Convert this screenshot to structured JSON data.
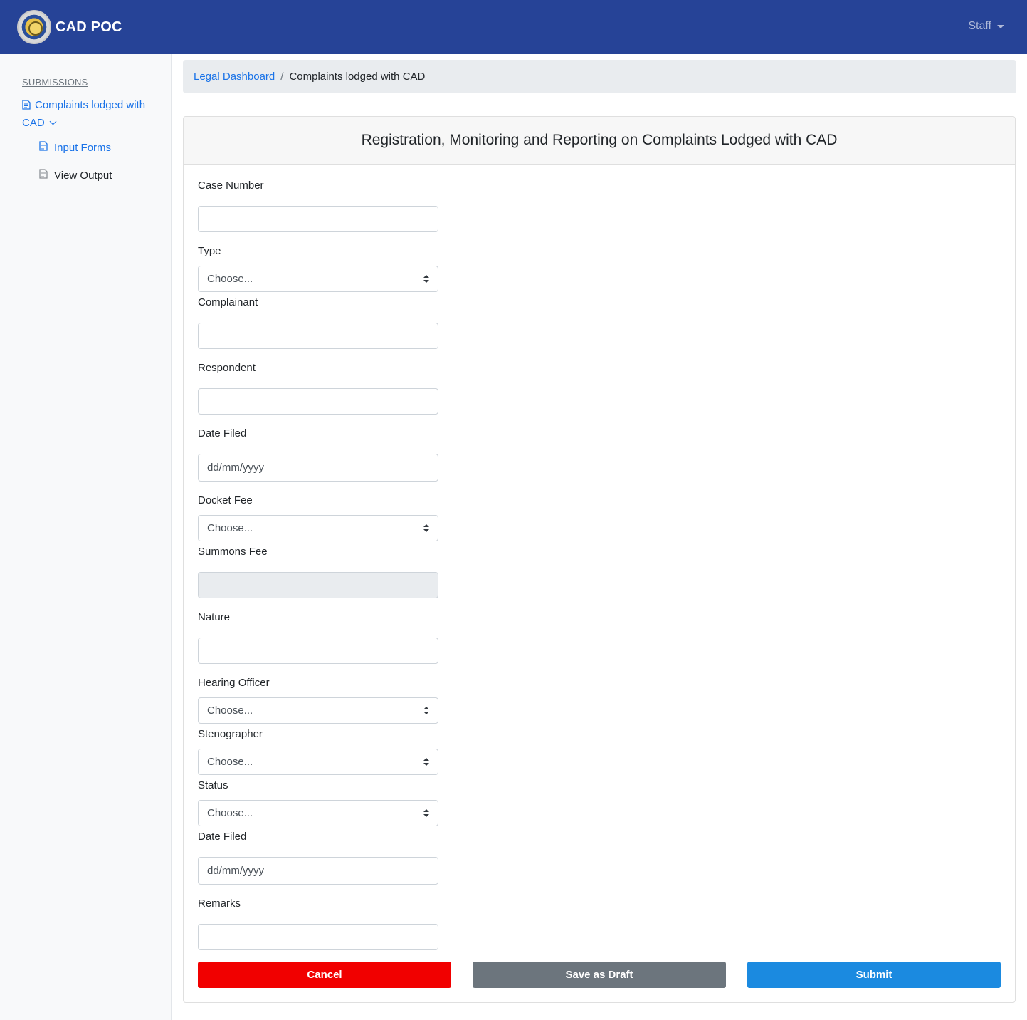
{
  "navbar": {
    "brand": "CAD POC",
    "user_menu": "Staff"
  },
  "sidebar": {
    "heading": "SUBMISSIONS",
    "main_item": "Complaints lodged with CAD",
    "sub_items": [
      "Input Forms",
      "View Output"
    ]
  },
  "breadcrumb": {
    "parent": "Legal Dashboard",
    "separator": "/",
    "current": "Complaints lodged with CAD"
  },
  "form": {
    "title": "Registration, Monitoring and Reporting on Complaints Lodged with CAD",
    "fields": {
      "case_number": {
        "label": "Case Number",
        "value": ""
      },
      "type": {
        "label": "Type",
        "value": "Choose..."
      },
      "complainant": {
        "label": "Complainant",
        "value": ""
      },
      "respondent": {
        "label": "Respondent",
        "value": ""
      },
      "date_filed": {
        "label": "Date Filed",
        "placeholder": "dd/mm/yyyy"
      },
      "docket_fee": {
        "label": "Docket Fee",
        "value": "Choose..."
      },
      "summons_fee": {
        "label": "Summons Fee",
        "value": ""
      },
      "nature": {
        "label": "Nature",
        "value": ""
      },
      "hearing_officer": {
        "label": "Hearing Officer",
        "value": "Choose..."
      },
      "stenographer": {
        "label": "Stenographer",
        "value": "Choose..."
      },
      "status": {
        "label": "Status",
        "value": "Choose..."
      },
      "date_filed_2": {
        "label": "Date Filed",
        "placeholder": "dd/mm/yyyy"
      },
      "remarks": {
        "label": "Remarks",
        "value": ""
      }
    },
    "buttons": {
      "cancel": "Cancel",
      "draft": "Save as Draft",
      "submit": "Submit"
    }
  },
  "colors": {
    "navbar": "#264397",
    "link": "#1a73e8",
    "cancel": "#f10000",
    "draft": "#6c757d",
    "submit": "#1b8ae0"
  }
}
